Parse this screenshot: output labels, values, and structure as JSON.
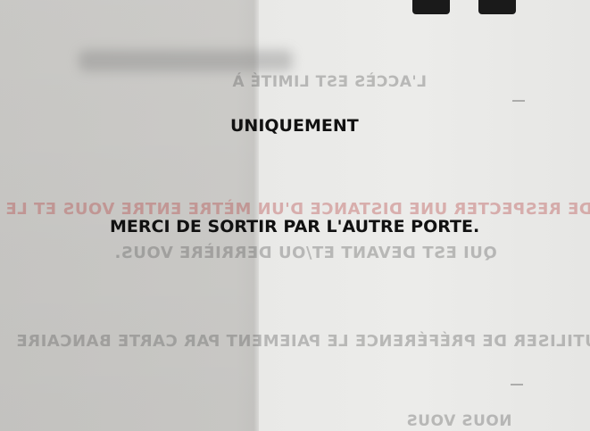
{
  "front_text": {
    "line1": "UNIQUEMENT",
    "line2": "MERCI DE SORTIR PAR L'AUTRE PORTE."
  },
  "back_text": {
    "line_a": "L'ACCÈS EST LIMITÉ À",
    "line_b": "MERCI DE RESPECTER UNE DISTANCE D'UN MÈTRE ENTRE VOUS ET LE",
    "line_c": "QUI EST DEVANT ET/OU DERRIÈRE VOUS.",
    "line_d": "UTILISER DE PRÉFÉRENCE LE PAIEMENT PAR CARTE BANCAIRE",
    "line_e": "NOUS VOUS"
  },
  "colors": {
    "front_ink": "#111111",
    "back_ink": "#7a7a7a",
    "accent_red": "#c43c3c"
  }
}
